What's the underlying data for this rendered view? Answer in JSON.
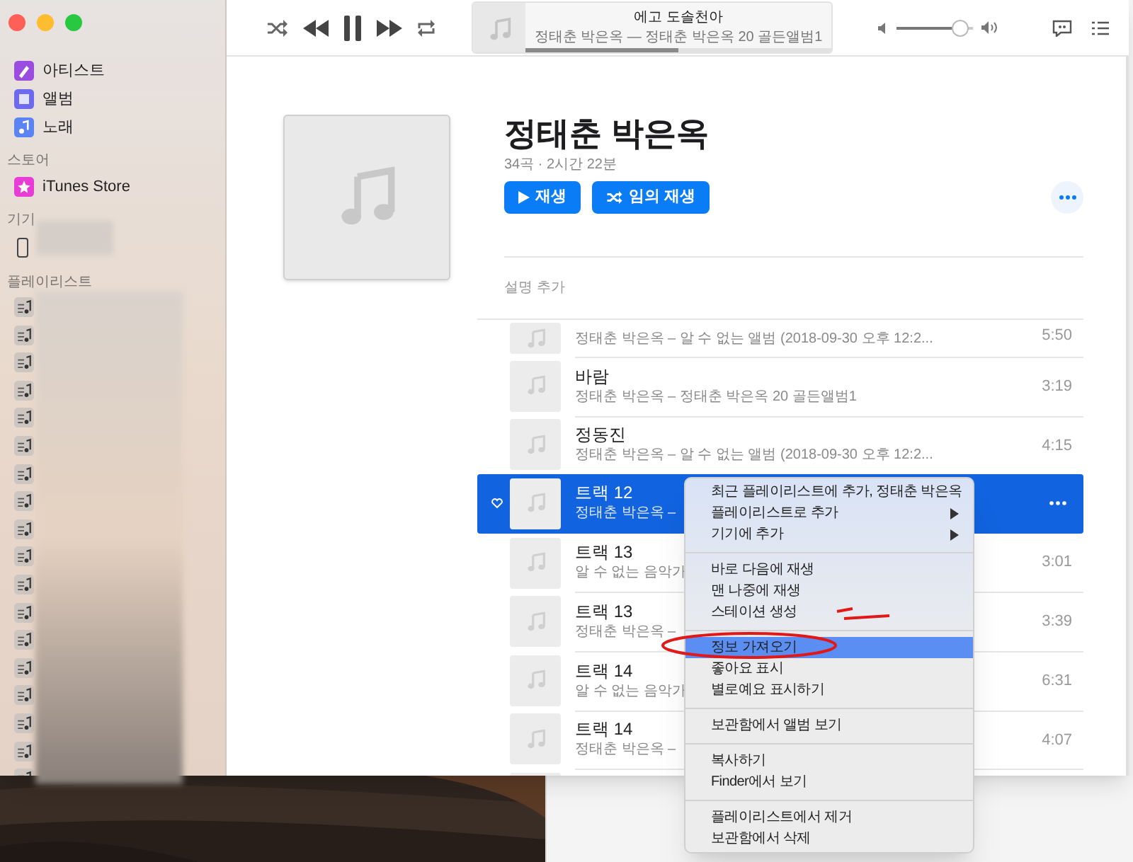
{
  "sidebar": {
    "library_items": [
      {
        "label": "아티스트",
        "color": "#9b4de0"
      },
      {
        "label": "앨범",
        "color": "#6d6af0"
      },
      {
        "label": "노래",
        "color": "#5a84f2"
      }
    ],
    "sections": [
      {
        "heading": "스토어",
        "items": [
          {
            "label": "iTunes Store",
            "color": "#e83cd6"
          }
        ]
      },
      {
        "heading": "기기"
      },
      {
        "heading": "플레이리스트"
      }
    ]
  },
  "player": {
    "now_playing": {
      "title": "에고 도솔천아",
      "subtitle": "정태춘 박은옥 — 정태춘 박은옥 20 골든앨범1",
      "level": 0.5
    },
    "volume": {
      "level": 0.94
    }
  },
  "album": {
    "title": "정태춘 박은옥",
    "meta": "34곡 · 2시간 22분",
    "buttons": [
      {
        "kind": "play",
        "label": "재생"
      },
      {
        "kind": "shuffle",
        "label": "임의 재생"
      }
    ],
    "description": "설명 추가"
  },
  "tracks": [
    {
      "subtitle": "정태춘 박은옥 – 알 수 없는 앨범 (2018-09-30 오후 12:2...",
      "duration": "5:50",
      "selected": false
    },
    {
      "title": "바람",
      "subtitle": "정태춘 박은옥 – 정태춘 박은옥 20 골든앨범1",
      "duration": "3:19",
      "selected": false
    },
    {
      "title": "정동진",
      "subtitle": "정태춘 박은옥 – 알 수 없는 앨범 (2018-09-30 오후 12:2...",
      "duration": "4:15",
      "selected": false
    },
    {
      "title": "트랙 12",
      "subtitle": "정태춘 박은옥 –",
      "selected": true
    },
    {
      "title": "트랙 13",
      "subtitle": "알 수 없는 음악가",
      "duration": "3:01",
      "selected": false
    },
    {
      "title": "트랙 13",
      "subtitle": "정태춘 박은옥 –",
      "duration": "3:39",
      "selected": false
    },
    {
      "title": "트랙 14",
      "subtitle": "알 수 없는 음악가",
      "duration": "6:31",
      "selected": false
    },
    {
      "title": "트랙 14",
      "subtitle": "정태춘 박은옥 –",
      "duration": "4:07",
      "selected": false
    },
    {
      "selected": false
    }
  ],
  "context_menu": {
    "sections": [
      [
        {
          "label": "최근 플레이리스트에 추가, 정태춘 박은옥",
          "submenu": false,
          "selected": false
        },
        {
          "label": "플레이리스트로 추가",
          "submenu": true,
          "selected": false
        },
        {
          "label": "기기에 추가",
          "submenu": true,
          "selected": false
        }
      ],
      [
        {
          "label": "바로 다음에 재생",
          "submenu": false,
          "selected": false
        },
        {
          "label": "맨 나중에 재생",
          "submenu": false,
          "selected": false
        },
        {
          "label": "스테이션 생성",
          "submenu": false,
          "selected": false
        }
      ],
      [
        {
          "label": "정보 가져오기",
          "submenu": false,
          "selected": true
        },
        {
          "label": "좋아요 표시",
          "submenu": false,
          "selected": false
        },
        {
          "label": "별로예요 표시하기",
          "submenu": false,
          "selected": false
        }
      ],
      [
        {
          "label": "보관함에서 앨범 보기",
          "submenu": false,
          "selected": false
        }
      ],
      [
        {
          "label": "복사하기",
          "submenu": false,
          "selected": false
        },
        {
          "label": "Finder에서 보기",
          "submenu": false,
          "selected": false
        }
      ],
      [
        {
          "label": "플레이리스트에서 제거",
          "submenu": false,
          "selected": false
        },
        {
          "label": "보관함에서 삭제",
          "submenu": false,
          "selected": false
        }
      ]
    ]
  }
}
